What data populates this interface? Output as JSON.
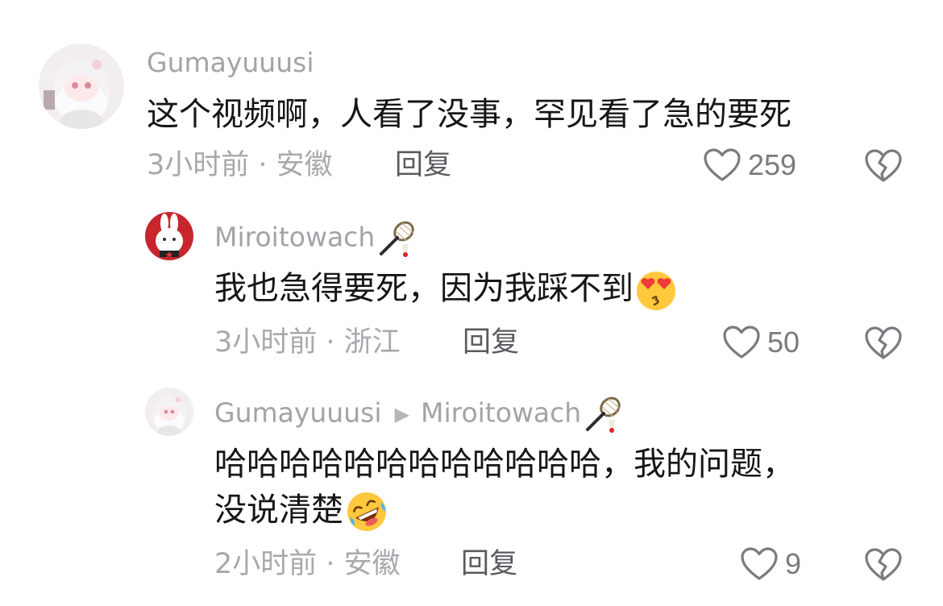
{
  "comments": [
    {
      "username": "Gumayuuusi",
      "text": "这个视频啊，人看了没事，罕见看了急的要死",
      "time_location": "3小时前 · 安徽",
      "reply_label": "回复",
      "likes": "259"
    },
    {
      "username": "Miroitowach",
      "text": "我也急得要死，因为我踩不到",
      "time_location": "3小时前 · 浙江",
      "reply_label": "回复",
      "likes": "50"
    },
    {
      "username": "Gumayuuusi",
      "reply_to": "Miroitowach",
      "text_line1": "哈哈哈哈哈哈哈哈哈哈哈哈，我的问题，",
      "text_line2": "没说清楚",
      "time_location": "2小时前 · 安徽",
      "reply_label": "回复",
      "likes": "9"
    }
  ],
  "colors": {
    "username": "#a3a3a8",
    "text": "#161616",
    "meta": "#a8a8ad",
    "reply": "#5a5a5f"
  },
  "icons": [
    "heart-outline-icon",
    "broken-heart-icon",
    "badminton-racket-emoji",
    "heart-eyes-emoji",
    "rofl-emoji"
  ]
}
